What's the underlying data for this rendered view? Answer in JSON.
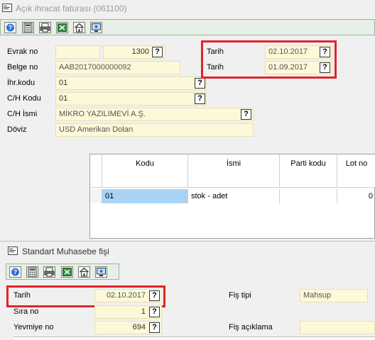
{
  "window": {
    "title": "Açık ihracat faturası (061100)"
  },
  "toolbar": {
    "icons": [
      "help-icon",
      "calculator-icon",
      "print-icon",
      "excel-icon",
      "home-icon",
      "screen-icon"
    ]
  },
  "form": {
    "evrak_no": {
      "label": "Evrak no",
      "seri": "",
      "sira": "1300"
    },
    "belge_no": {
      "label": "Belge no",
      "value": "AAB2017000000092"
    },
    "ihr_kodu": {
      "label": "İhr.kodu",
      "value": "01"
    },
    "ch_kodu": {
      "label": "C/H Kodu",
      "value": "01"
    },
    "ch_ismi": {
      "label": "C/H İsmi",
      "value": "MİKRO YAZILIMEVİ A.Ş."
    },
    "doviz": {
      "label": "Döviz",
      "value": "USD Amerikan Doları"
    },
    "tarih1": {
      "label": "Tarih",
      "value": "02.10.2017"
    },
    "tarih2": {
      "label": "Tarih",
      "value": "01.09.2017"
    },
    "qmark": "?"
  },
  "grid": {
    "columns": [
      "Kodu",
      "İsmi",
      "Parti kodu",
      "Lot no"
    ],
    "rows": [
      {
        "kodu": "01",
        "ismi": "stok - adet",
        "parti": "",
        "lot": "0"
      }
    ]
  },
  "sub": {
    "title": "Standart Muhasebe fişi",
    "tarih": {
      "label": "Tarih",
      "value": "02.10.2017"
    },
    "sira_no": {
      "label": "Sıra no",
      "value": "1"
    },
    "yevmiye_no": {
      "label": "Yevmiye no",
      "value": "694"
    },
    "fis_tipi": {
      "label": "Fiş tipi",
      "value": "Mahsup"
    },
    "fis_aciklama": {
      "label": "Fiş açıklama",
      "value": ""
    }
  },
  "colors": {
    "highlight": "#e0242b",
    "field_bg": "#fdf8d8",
    "selected_cell": "#a9d3f5"
  }
}
